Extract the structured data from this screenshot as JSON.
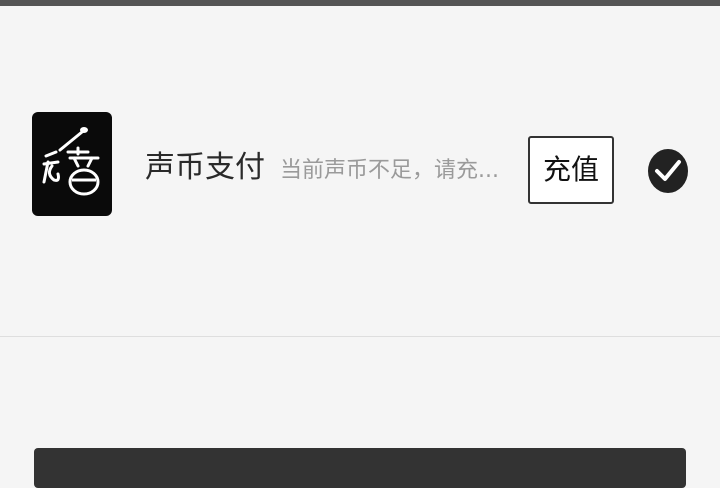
{
  "payment": {
    "method_name": "声币支付",
    "method_hint": "当前声币不足，请充...",
    "recharge_label": "充值",
    "selected": true,
    "app_icon": "mic-music-logo-icon",
    "check_icon": "check-circle-icon"
  },
  "colors": {
    "background": "#f5f5f5",
    "icon_bg": "#0a0a0a",
    "button_dark": "#333333",
    "hint_text": "#9a9a9a"
  }
}
